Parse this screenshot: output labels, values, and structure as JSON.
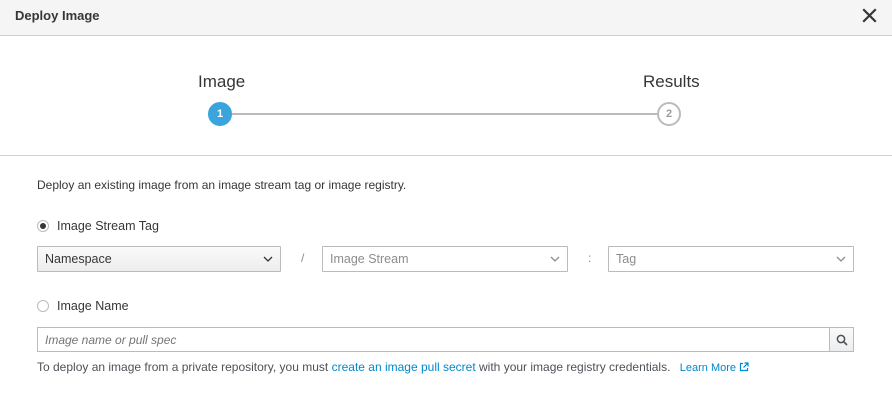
{
  "modal": {
    "title": "Deploy Image"
  },
  "wizard": {
    "steps": [
      {
        "label": "Image",
        "number": "1",
        "state": "active"
      },
      {
        "label": "Results",
        "number": "2",
        "state": "inactive"
      }
    ]
  },
  "form": {
    "intro": "Deploy an existing image from an image stream tag or image registry.",
    "image_stream_tag": {
      "label": "Image Stream Tag",
      "checked": true,
      "namespace_select": "Namespace",
      "separator_1": "/",
      "image_stream_select": "Image Stream",
      "separator_2": ":",
      "tag_select": "Tag"
    },
    "image_name": {
      "label": "Image Name",
      "checked": false,
      "input_placeholder": "Image name or pull spec",
      "input_value": ""
    },
    "help": {
      "prefix": "To deploy an image from a private repository, you must",
      "link": "create an image pull secret",
      "suffix": "with your image registry credentials.",
      "learn_more": "Learn More"
    }
  },
  "colors": {
    "accent": "#39a5dc",
    "link": "#0088ce",
    "border": "#bbbbbb",
    "header_bg": "#f5f5f5"
  },
  "icons": {
    "close": "close-icon",
    "chevron": "chevron-down-icon",
    "search": "search-icon",
    "external_link": "external-link-icon"
  }
}
